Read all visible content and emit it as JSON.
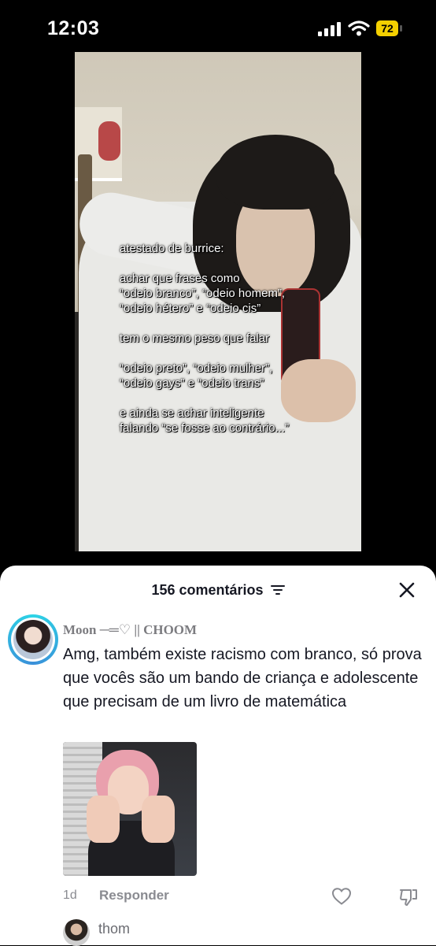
{
  "status_bar": {
    "time": "12:03",
    "battery": "72",
    "battery_color": "#f4d000"
  },
  "video": {
    "overlay_lines": [
      "atestado de burrice:",
      "",
      "achar que frases como",
      "“odeio branco”, “odeio homem”,",
      "“odeio hétero” e “odeio cis”",
      "",
      "tem o mesmo peso que falar",
      "",
      "“odeio preto”, “odeio mulher”,",
      "“odeio gays” e “odeio trans”",
      "",
      "e ainda se achar inteligente",
      "falando “se fosse ao contrário...”"
    ]
  },
  "comments_sheet": {
    "count_label": "156 comentários",
    "filter_icon": "filter-icon",
    "close_icon": "close-icon",
    "comment": {
      "username": "Moon ─═♡ || CHOOM",
      "text": "Amg, também existe racismo com branco, só prova que vocês são um bando de criança e adolescente que precisam de um livro de matemática",
      "time_ago": "1d",
      "reply_label": "Responder",
      "avatar_ring_color": "#2dd4e6"
    },
    "next_comment": {
      "username": "thom"
    }
  }
}
